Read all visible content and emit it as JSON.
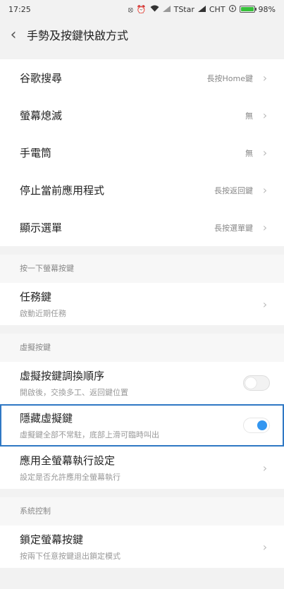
{
  "status_bar": {
    "time": "17:25",
    "carrier1": "TStar",
    "carrier2": "CHT",
    "battery": "98%",
    "icons": [
      "no-disturb-icon",
      "alarm-icon",
      "wifi-icon",
      "signal-icon",
      "signal-icon",
      "charging-icon",
      "battery-icon"
    ],
    "battery_color": "#36c23a"
  },
  "header": {
    "title": "手勢及按鍵快啟方式"
  },
  "shortcuts": [
    {
      "label": "谷歌搜尋",
      "value": "長按Home鍵"
    },
    {
      "label": "螢幕熄滅",
      "value": "無"
    },
    {
      "label": "手電筒",
      "value": "無"
    },
    {
      "label": "停止當前應用程式",
      "value": "長按返回鍵"
    },
    {
      "label": "顯示選單",
      "value": "長按選單鍵"
    }
  ],
  "section_tap": {
    "title": "按一下螢幕按鍵",
    "task_label": "任務鍵",
    "task_sub": "啟動近期任務"
  },
  "section_virtual": {
    "title": "虛擬按鍵",
    "order_label": "虛擬按鍵調換順序",
    "order_sub": "開啟後，交換多工、返回鍵位置",
    "order_enabled": false,
    "hide_label": "隱藏虛擬鍵",
    "hide_sub": "虛擬鍵全部不常駐，底部上滑可臨時叫出",
    "hide_enabled": true,
    "fullscreen_label": "應用全螢幕執行設定",
    "fullscreen_sub": "設定是否允許應用全螢幕執行"
  },
  "section_system": {
    "title": "系統控制",
    "lock_label": "鎖定螢幕按鍵",
    "lock_sub": "按兩下任意按鍵退出鎖定模式"
  },
  "colors": {
    "accent": "#3396f0",
    "highlight_border": "#2f78c4"
  }
}
